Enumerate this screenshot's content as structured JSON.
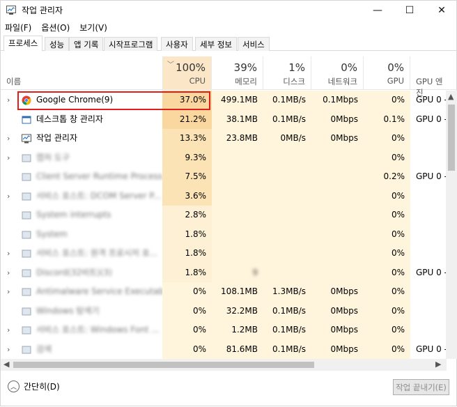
{
  "window": {
    "title": "작업 관리자",
    "minimize": "—",
    "maximize": "☐",
    "close": "✕"
  },
  "menu": [
    "파일(F)",
    "옵션(O)",
    "보기(V)"
  ],
  "tabs": [
    "프로세스",
    "성능",
    "앱 기록",
    "시작프로그램",
    "사용자",
    "세부 정보",
    "서비스"
  ],
  "columns": {
    "name": "이름",
    "cpu": {
      "pct": "100%",
      "label": "CPU"
    },
    "mem": {
      "pct": "39%",
      "label": "메모리"
    },
    "disk": {
      "pct": "1%",
      "label": "디스크"
    },
    "net": {
      "pct": "0%",
      "label": "네트워크"
    },
    "gpu": {
      "pct": "0%",
      "label": "GPU"
    },
    "engine": {
      "label": "GPU 엔진"
    }
  },
  "colors": {
    "highlight": "#e01e1e",
    "cpu_strong": "#f9d79e",
    "cpu_mid": "#fbe3b5",
    "cpu_light": "#fdf0d4",
    "load_bg": "#fff4dc"
  },
  "rows": [
    {
      "name": "Google Chrome(9)",
      "cpu": "37.0%",
      "mem": "499.1MB",
      "disk": "0.1MB/s",
      "net": "0.1Mbps",
      "gpu": "0%",
      "engine": "GPU 0 -",
      "expand": true,
      "icon": "chrome-icon",
      "blurred": false
    },
    {
      "name": "데스크톱 창 관리자",
      "cpu": "21.2%",
      "mem": "38.1MB",
      "disk": "0.1MB/s",
      "net": "0Mbps",
      "gpu": "0.1%",
      "engine": "GPU 0 -",
      "expand": false,
      "icon": "window-icon",
      "blurred": false
    },
    {
      "name": "작업 관리자",
      "cpu": "13.3%",
      "mem": "23.8MB",
      "disk": "0MB/s",
      "net": "0Mbps",
      "gpu": "0%",
      "engine": "",
      "expand": true,
      "icon": "task-manager-icon",
      "blurred": false
    },
    {
      "name": "캡처 도구",
      "cpu": "9.3%",
      "mem": "",
      "disk": "",
      "net": "",
      "gpu": "0%",
      "engine": "",
      "expand": true,
      "icon": "snip-icon",
      "blurred": true
    },
    {
      "name": "Client Server Runtime Process",
      "cpu": "7.5%",
      "mem": "",
      "disk": "",
      "net": "",
      "gpu": "0.2%",
      "engine": "GPU 0 -",
      "expand": false,
      "icon": "system-icon",
      "blurred": true
    },
    {
      "name": "서비스 호스트: DCOM Server P...",
      "cpu": "3.6%",
      "mem": "",
      "disk": "",
      "net": "",
      "gpu": "0%",
      "engine": "",
      "expand": true,
      "icon": "gear-icon",
      "blurred": true
    },
    {
      "name": "System interrupts",
      "cpu": "2.8%",
      "mem": "",
      "disk": "",
      "net": "",
      "gpu": "0%",
      "engine": "",
      "expand": false,
      "icon": "system-icon",
      "blurred": true
    },
    {
      "name": "System",
      "cpu": "1.8%",
      "mem": "",
      "disk": "",
      "net": "",
      "gpu": "0%",
      "engine": "",
      "expand": false,
      "icon": "system-icon",
      "blurred": true
    },
    {
      "name": "서비스 호스트: 원격 프로시저 호...",
      "cpu": "1.8%",
      "mem": "",
      "disk": "",
      "net": "",
      "gpu": "0%",
      "engine": "",
      "expand": true,
      "icon": "gear-icon",
      "blurred": true
    },
    {
      "name": "Discord(32비트)(3)",
      "cpu": "1.8%",
      "mem": "9",
      "disk": "",
      "net": "",
      "gpu": "0%",
      "engine": "GPU 0 -",
      "expand": true,
      "icon": "discord-icon",
      "blurred": true
    },
    {
      "name": "Antimalware Service Executable",
      "cpu": "0%",
      "mem": "108.1MB",
      "disk": "1.3MB/s",
      "net": "0Mbps",
      "gpu": "0%",
      "engine": "",
      "expand": true,
      "icon": "shield-icon",
      "blurred": true
    },
    {
      "name": "Windows 탐색기",
      "cpu": "0%",
      "mem": "32.2MB",
      "disk": "0.1MB/s",
      "net": "0Mbps",
      "gpu": "0%",
      "engine": "",
      "expand": false,
      "icon": "folder-icon",
      "blurred": true
    },
    {
      "name": "서비스 호스트: Windows Font ...",
      "cpu": "0%",
      "mem": "1.2MB",
      "disk": "0.1MB/s",
      "net": "0Mbps",
      "gpu": "0%",
      "engine": "",
      "expand": true,
      "icon": "gear-icon",
      "blurred": true
    },
    {
      "name": "검색",
      "cpu": "0%",
      "mem": "81.6MB",
      "disk": "0.1MB/s",
      "net": "0Mbps",
      "gpu": "0%",
      "engine": "GPU 0 -",
      "expand": true,
      "icon": "search-icon",
      "blurred": true
    }
  ],
  "footer": {
    "fewer": "간단히(D)",
    "end_task": "작업 끝내기(E)"
  }
}
